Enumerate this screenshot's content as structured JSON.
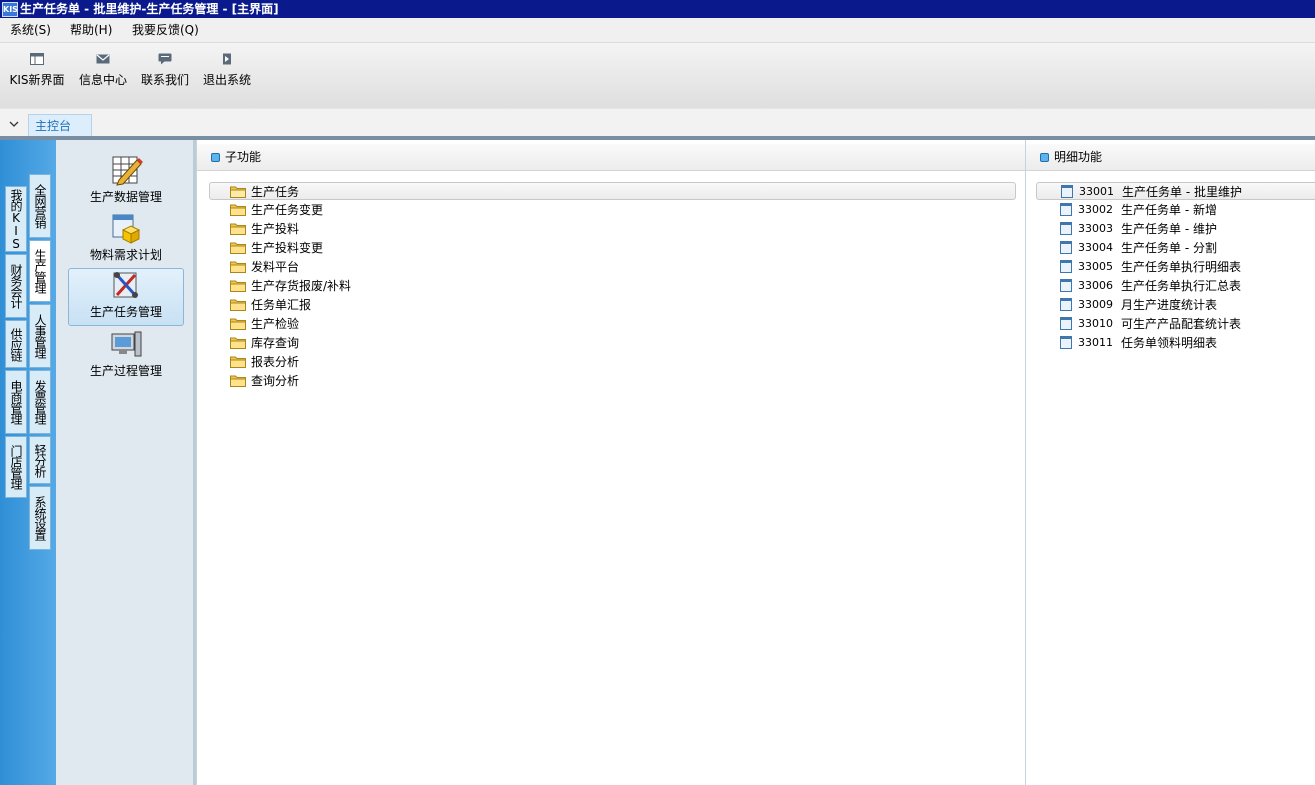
{
  "window": {
    "logo": "KIS",
    "title": "生产任务单 - 批里维护-生产任务管理 - [主界面]"
  },
  "menu": [
    "系统(S)",
    "帮助(H)",
    "我要反馈(Q)"
  ],
  "toolbar": [
    {
      "label": "KIS新界面",
      "icon": "layout-icon"
    },
    {
      "label": "信息中心",
      "icon": "mail-icon"
    },
    {
      "label": "联系我们",
      "icon": "chat-icon"
    },
    {
      "label": "退出系统",
      "icon": "exit-icon"
    }
  ],
  "tabs": {
    "active": "主控台"
  },
  "leftnav": {
    "outer": [
      "我的KIS",
      "财务会计",
      "供应链",
      "电商管理",
      "门店管理"
    ],
    "inner": [
      "全网营销",
      "生产管理",
      "人事管理",
      "发票管理",
      "轻分析",
      "系统设置"
    ],
    "active_inner": "生产管理"
  },
  "modules": [
    {
      "label": "生产数据管理",
      "icon": "table-edit-icon"
    },
    {
      "label": "物料需求计划",
      "icon": "box-icon"
    },
    {
      "label": "生产任务管理",
      "icon": "tools-icon",
      "selected": true
    },
    {
      "label": "生产过程管理",
      "icon": "monitor-icon"
    }
  ],
  "subpanel": {
    "title": "子功能",
    "items": [
      "生产任务",
      "生产任务变更",
      "生产投料",
      "生产投料变更",
      "发料平台",
      "生产存货报废/补料",
      "任务单汇报",
      "生产检验",
      "库存查询",
      "报表分析",
      "查询分析"
    ],
    "selected": "生产任务"
  },
  "detailpanel": {
    "title": "明细功能",
    "items": [
      {
        "code": "33001",
        "name": "生产任务单 - 批里维护",
        "selected": true
      },
      {
        "code": "33002",
        "name": "生产任务单 - 新增"
      },
      {
        "code": "33003",
        "name": "生产任务单 - 维护"
      },
      {
        "code": "33004",
        "name": "生产任务单 - 分割"
      },
      {
        "code": "33005",
        "name": "生产任务单执行明细表"
      },
      {
        "code": "33006",
        "name": "生产任务单执行汇总表"
      },
      {
        "code": "33009",
        "name": "月生产进度统计表"
      },
      {
        "code": "33010",
        "name": "可生产产品配套统计表"
      },
      {
        "code": "33011",
        "name": "任务单领料明细表"
      }
    ]
  },
  "colors": {
    "titlebar": "#0a1a8c",
    "leftnav": "#3a9be0",
    "accent": "#1d6fb8",
    "folder": "#f3c64a"
  }
}
